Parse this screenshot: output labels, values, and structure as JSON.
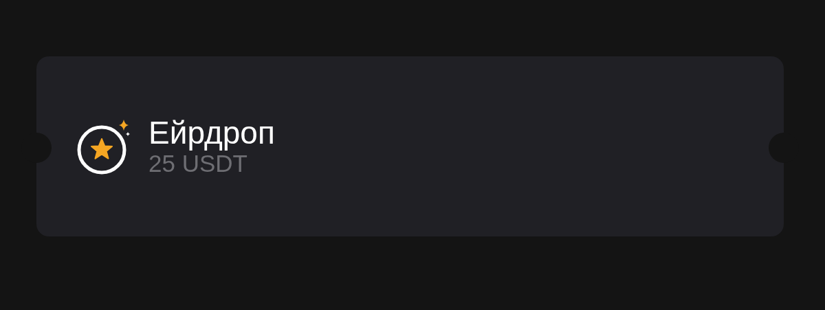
{
  "card": {
    "title": "Ейрдроп",
    "amount": "25 USDT"
  }
}
